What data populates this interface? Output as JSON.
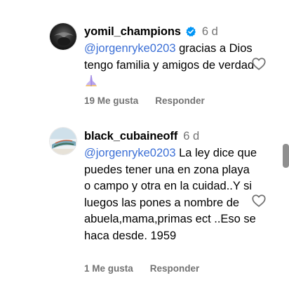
{
  "comments": [
    {
      "username": "yomil_champions",
      "verified": true,
      "time": "6 d",
      "mention": "@jorgenryke0203",
      "text": " gracias a Dios tengo familia y amigos de verdad ",
      "emoji": "praying-hands",
      "likes": "19 Me gusta",
      "reply": "Responder"
    },
    {
      "username": "black_cubaineoff",
      "verified": false,
      "time": "6 d",
      "mention": "@jorgenryke0203",
      "text": " La ley dice que puedes tener una en zona playa o campo y otra en la cuidad..Y si luegos las pones a nombre de abuela,mama,primas ect ..Eso se haca desde. 1959",
      "likes": "1 Me gusta",
      "reply": "Responder"
    }
  ],
  "icons": {
    "verified": "verified-badge-icon",
    "like": "heart-icon",
    "emoji": "praying-hands-emoji"
  },
  "colors": {
    "mention": "#3b6fd6",
    "meta": "#737373",
    "verified": "#0095f6"
  }
}
